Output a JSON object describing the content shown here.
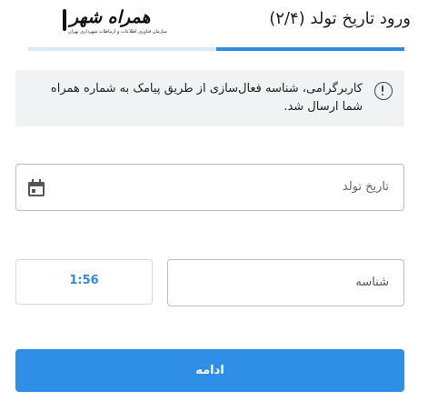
{
  "header": {
    "title": "ورود تاریخ تولد (۲/۴)",
    "logo": {
      "text": "همراه شهر",
      "subtext": "سازمان فناوری اطلاعات و ارتباطات شهرداری تهران"
    }
  },
  "progress": {
    "step": 2,
    "total": 4,
    "fraction": 0.5
  },
  "alert": {
    "icon": "info-icon",
    "message": "کاربرگرامی، شناسه فعال‌سازی از طریق پیامک به شماره همراه شما ارسال شد."
  },
  "birthdate": {
    "placeholder": "تاریخ تولد",
    "icon": "calendar-icon"
  },
  "code": {
    "placeholder": "شناسه"
  },
  "timer": {
    "value": "1:56"
  },
  "actions": {
    "continue_label": "ادامه"
  },
  "colors": {
    "accent": "#2f8fe6",
    "progress_track": "#dbe9f8",
    "alert_bg": "#f1f2f4"
  }
}
